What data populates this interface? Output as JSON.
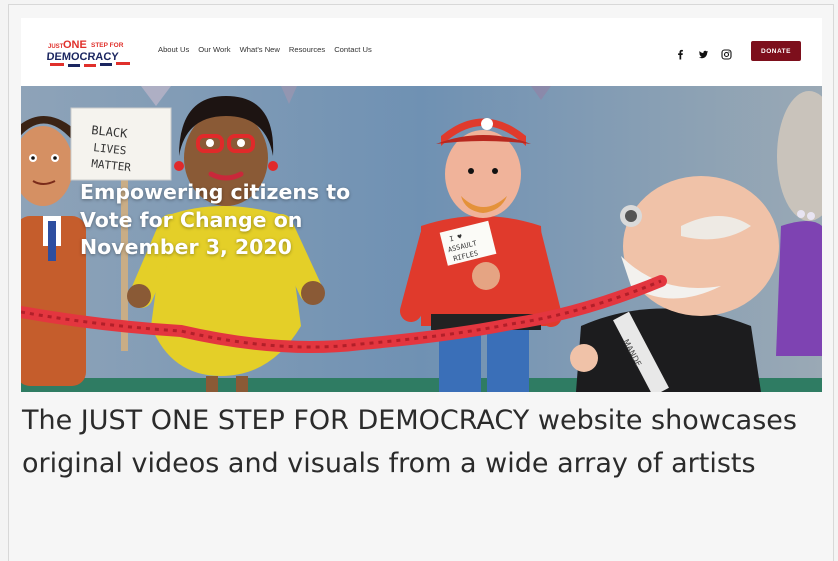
{
  "header": {
    "logo": {
      "line1_small": "JUST",
      "line1_big": "ONE",
      "line1_rest": "STEP FOR",
      "line2": "DEMOCRACY"
    },
    "nav": [
      {
        "label": "About Us"
      },
      {
        "label": "Our Work"
      },
      {
        "label": "What's New"
      },
      {
        "label": "Resources"
      },
      {
        "label": "Contact Us"
      }
    ],
    "social_icons": [
      "facebook-icon",
      "twitter-icon",
      "instagram-icon"
    ],
    "donate_label": "DONATE"
  },
  "hero": {
    "title": "Empowering citizens to Vote for Change on November 3, 2020",
    "sign_text": [
      "BLACK",
      "LIVES",
      "MATTER"
    ],
    "badge_text": [
      "I ♥",
      "ASSAULT",
      "RIFLES"
    ],
    "sash_text": "MANDE"
  },
  "caption": "The JUST ONE STEP FOR DEMOCRACY website showcases original videos and visuals from a wide array of artists",
  "colors": {
    "accent": "#7d0f1c",
    "logo_red": "#e0302b",
    "logo_navy": "#1b2660",
    "sky": "#7a97b4"
  }
}
